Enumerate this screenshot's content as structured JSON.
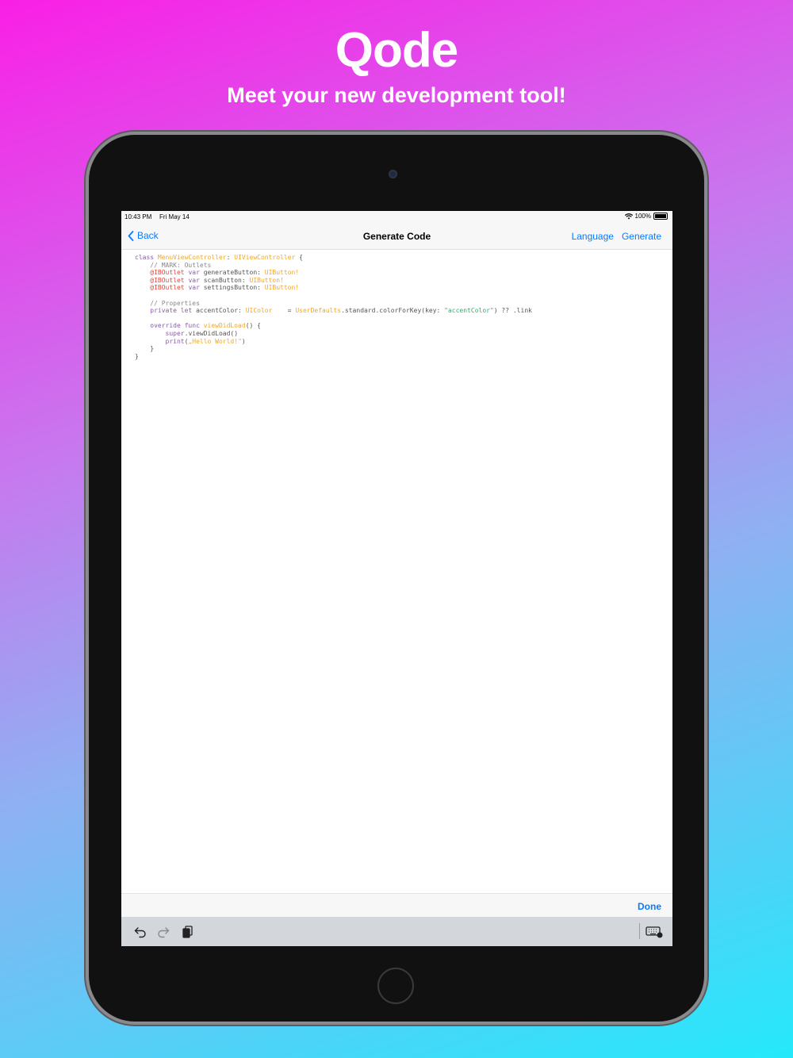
{
  "hero": {
    "title": "Qode",
    "subtitle": "Meet your new development tool!"
  },
  "status_bar": {
    "time": "10:43 PM",
    "date": "Fri May 14",
    "battery": "100%"
  },
  "nav": {
    "back_label": "Back",
    "title": "Generate Code",
    "language_label": "Language",
    "generate_label": "Generate"
  },
  "code": {
    "lines": [
      [
        {
          "t": "class ",
          "c": "kw"
        },
        {
          "t": "MenuViewController",
          "c": "ty"
        },
        {
          "t": ": ",
          "c": ""
        },
        {
          "t": "UIViewController",
          "c": "ty"
        },
        {
          "t": " {",
          "c": ""
        }
      ],
      [
        {
          "t": "    // MARK: Outlets",
          "c": "cm"
        }
      ],
      [
        {
          "t": "    @IBOutlet ",
          "c": "at"
        },
        {
          "t": "var ",
          "c": "kw"
        },
        {
          "t": "generateButton: ",
          "c": ""
        },
        {
          "t": "UIButton!",
          "c": "ty"
        }
      ],
      [
        {
          "t": "    @IBOutlet ",
          "c": "at"
        },
        {
          "t": "var ",
          "c": "kw"
        },
        {
          "t": "scanButton: ",
          "c": ""
        },
        {
          "t": "UIButton!",
          "c": "ty"
        }
      ],
      [
        {
          "t": "    @IBOutlet ",
          "c": "at"
        },
        {
          "t": "var ",
          "c": "kw"
        },
        {
          "t": "settingsButton: ",
          "c": ""
        },
        {
          "t": "UIButton!",
          "c": "ty"
        }
      ],
      [
        {
          "t": "",
          "c": ""
        }
      ],
      [
        {
          "t": "    // Properties",
          "c": "cm"
        }
      ],
      [
        {
          "t": "    private let ",
          "c": "kw"
        },
        {
          "t": "accentColor: ",
          "c": ""
        },
        {
          "t": "UIColor",
          "c": "ty"
        },
        {
          "t": "    = ",
          "c": ""
        },
        {
          "t": "UserDefaults",
          "c": "ty"
        },
        {
          "t": ".standard.colorForKey(key: ",
          "c": ""
        },
        {
          "t": "\"accentColor\"",
          "c": "st"
        },
        {
          "t": ") ?? .link",
          "c": ""
        }
      ],
      [
        {
          "t": "",
          "c": ""
        }
      ],
      [
        {
          "t": "    override func ",
          "c": "kw"
        },
        {
          "t": "viewDidLoad",
          "c": "ty"
        },
        {
          "t": "() {",
          "c": ""
        }
      ],
      [
        {
          "t": "        super",
          "c": "kw"
        },
        {
          "t": ".viewDidLoad()",
          "c": ""
        }
      ],
      [
        {
          "t": "        print",
          "c": "kw"
        },
        {
          "t": "(",
          "c": ""
        },
        {
          "t": "„Hello World!\"",
          "c": "ty"
        },
        {
          "t": ")",
          "c": ""
        }
      ],
      [
        {
          "t": "    }",
          "c": ""
        }
      ],
      [
        {
          "t": "}",
          "c": ""
        }
      ]
    ]
  },
  "keyboard_toolbar": {
    "done_label": "Done",
    "icons": [
      "undo-icon",
      "redo-icon",
      "paste-icon",
      "keyboard-dismiss-icon"
    ]
  },
  "colors": {
    "accent": "#0a7aff",
    "keyword": "#8a5cad",
    "type": "#f2a72a",
    "attribute": "#e5463a",
    "string": "#2ab36f"
  }
}
